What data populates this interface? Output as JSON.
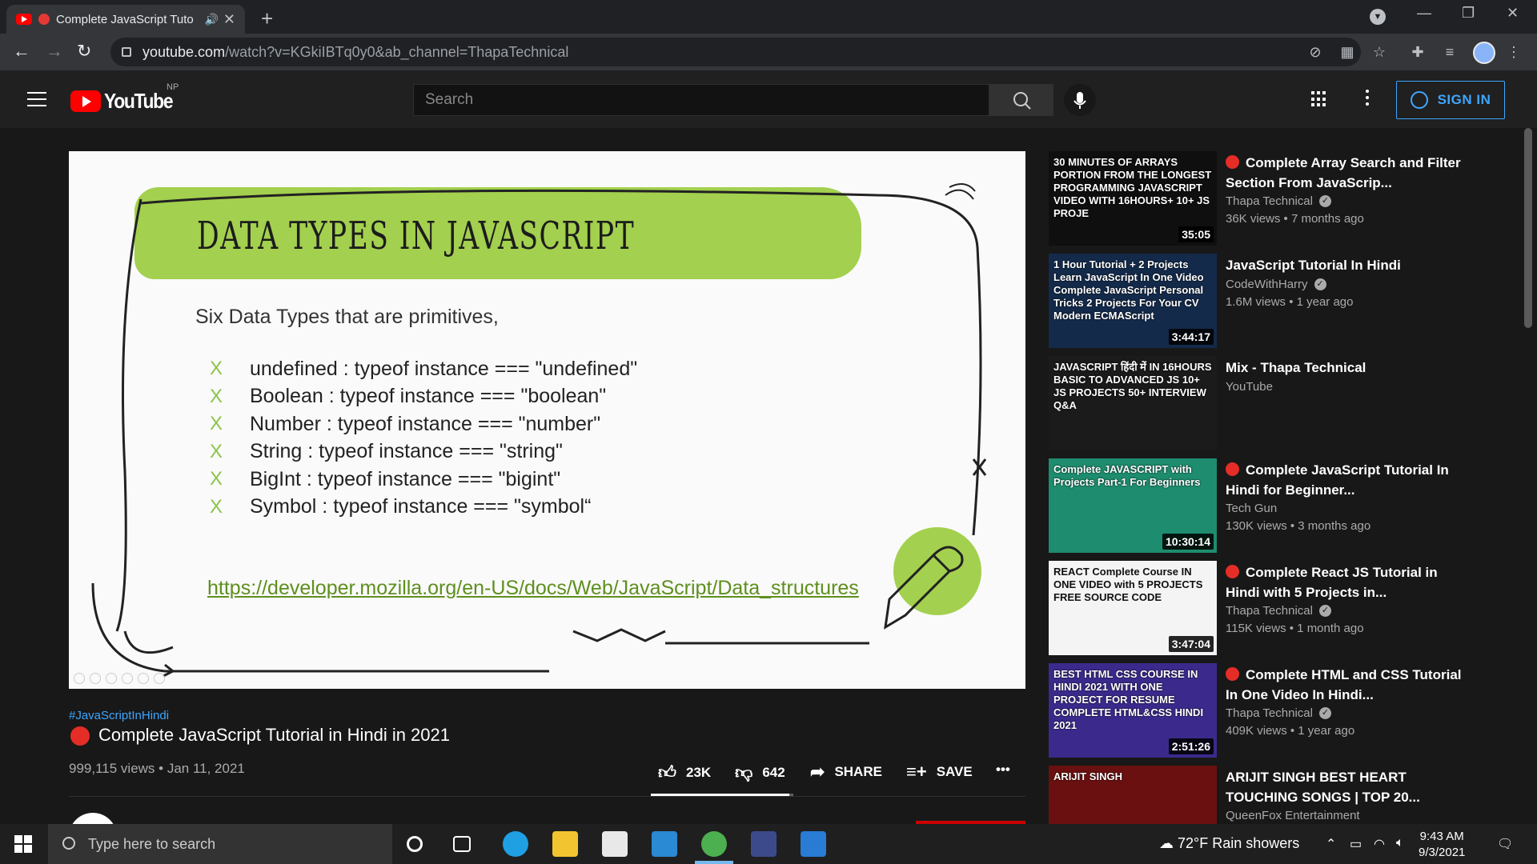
{
  "browser": {
    "tab_title": "Complete JavaScript Tuto",
    "new_tab": "+",
    "url_host": "youtube.com",
    "url_path": "/watch?v=KGkiIBTq0y0&ab_channel=ThapaTechnical"
  },
  "header": {
    "logo": "YouTube",
    "country": "NP",
    "search_placeholder": "Search",
    "signin_label": "SIGN IN"
  },
  "slide": {
    "title": "DATA TYPES IN JAVASCRIPT",
    "subtitle": "Six Data Types that are primitives,",
    "items": [
      {
        "mark": "X",
        "text": "undefined : typeof instance === \"undefined\""
      },
      {
        "mark": "X",
        "text": "Boolean : typeof instance === \"boolean\""
      },
      {
        "mark": "X",
        "text": "Number : typeof instance === \"number\""
      },
      {
        "mark": "X",
        "text": "String : typeof instance === \"string\""
      },
      {
        "mark": "X",
        "text": "BigInt : typeof instance === \"bigint\""
      },
      {
        "mark": "X",
        "text": "Symbol : typeof instance === \"symbol“"
      }
    ],
    "link": "https://developer.mozilla.org/en-US/docs/Web/JavaScript/Data_structures"
  },
  "video": {
    "hashtag": "#JavaScriptInHindi",
    "title": "Complete JavaScript Tutorial in Hindi in 2021",
    "views_date": "999,115 views • Jan 11, 2021",
    "likes": "23K",
    "dislikes": "642",
    "like_ratio": 0.97,
    "share_label": "SHARE",
    "save_label": "SAVE"
  },
  "recommendations": [
    {
      "title": "Complete Array Search and Filter Section From JavaScrip...",
      "live": true,
      "channel": "Thapa Technical",
      "verified": true,
      "meta": "36K views • 7 months ago",
      "duration": "35:05",
      "thumb_text": "30 MINUTES OF ARRAYS PORTION FROM THE LONGEST PROGRAMMING JAVASCRIPT VIDEO WITH 16HOURS+ 10+ JS PROJE",
      "thumb_bg": "#0f0f0f"
    },
    {
      "title": "JavaScript Tutorial In Hindi",
      "live": false,
      "channel": "CodeWithHarry",
      "verified": true,
      "meta": "1.6M views • 1 year ago",
      "duration": "3:44:17",
      "thumb_text": "1 Hour Tutorial + 2 Projects Learn JavaScript In One Video Complete JavaScript Personal Tricks 2 Projects For Your CV Modern ECMAScript",
      "thumb_bg": "#142a4a"
    },
    {
      "title": "Mix - Thapa Technical",
      "live": false,
      "channel": "YouTube",
      "verified": false,
      "meta": "",
      "duration": "",
      "thumb_text": "JAVASCRIPT हिंदी में IN 16HOURS BASIC TO ADVANCED JS 10+ JS PROJECTS 50+ INTERVIEW Q&A",
      "thumb_bg": "#1b1b1b"
    },
    {
      "title": "Complete JavaScript Tutorial In Hindi for Beginner...",
      "live": true,
      "channel": "Tech Gun",
      "verified": false,
      "meta": "130K views • 3 months ago",
      "duration": "10:30:14",
      "thumb_text": "Complete JAVASCRIPT with Projects Part-1 For Beginners",
      "thumb_bg": "#1e8c6e"
    },
    {
      "title": "Complete React JS Tutorial in Hindi with 5 Projects in...",
      "live": true,
      "channel": "Thapa Technical",
      "verified": true,
      "meta": "115K views • 1 month ago",
      "duration": "3:47:04",
      "thumb_text": "REACT Complete Course IN ONE VIDEO with 5 PROJECTS FREE SOURCE CODE",
      "thumb_bg": "#f4f4f4"
    },
    {
      "title": "Complete HTML and CSS Tutorial In One Video In Hindi...",
      "live": true,
      "channel": "Thapa Technical",
      "verified": true,
      "meta": "409K views • 1 year ago",
      "duration": "2:51:26",
      "thumb_text": "BEST HTML CSS COURSE IN HINDI 2021 WITH ONE PROJECT FOR RESUME COMPLETE HTML&CSS HINDI 2021",
      "thumb_bg": "#3b2a8c"
    },
    {
      "title": "ARIJIT SINGH BEST HEART TOUCHING SONGS | TOP 20...",
      "live": false,
      "channel": "QueenFox Entertainment",
      "verified": false,
      "meta": "",
      "duration": "",
      "thumb_text": "ARIJIT SINGH",
      "thumb_bg": "#6a1010"
    }
  ],
  "taskbar": {
    "search_placeholder": "Type here to search",
    "weather": "72°F  Rain showers",
    "time": "9:43 AM",
    "date": "9/3/2021"
  },
  "colors": {
    "accent": "#3ea6ff",
    "brand_red": "#ff0000",
    "slide_green": "#a3d04e"
  }
}
